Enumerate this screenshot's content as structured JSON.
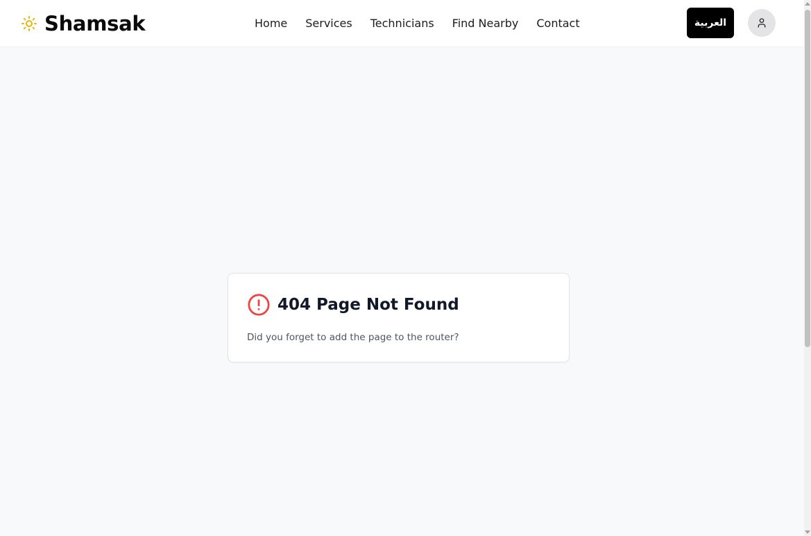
{
  "header": {
    "brand_name": "Shamsak",
    "brand_icon": "sun-icon",
    "nav_items": [
      {
        "label": "Home"
      },
      {
        "label": "Services"
      },
      {
        "label": "Technicians"
      },
      {
        "label": "Find Nearby"
      },
      {
        "label": "Contact"
      }
    ],
    "language_button_label": "العربية",
    "profile_icon": "user-icon"
  },
  "main": {
    "error_icon": "alert-circle-icon",
    "title": "404 Page Not Found",
    "message": "Did you forget to add the page to the router?"
  },
  "colors": {
    "brand_sun": "#eab308",
    "error": "#ef4444",
    "language_button_bg": "#000000",
    "page_bg": "#f8f9fb"
  }
}
